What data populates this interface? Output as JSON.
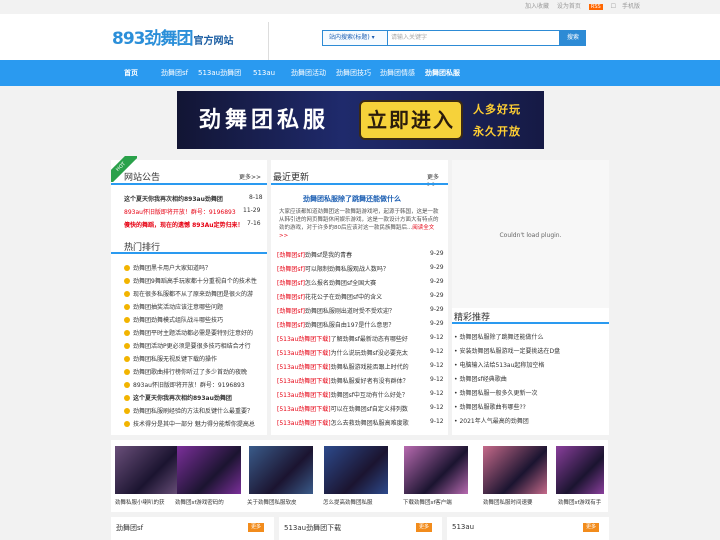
{
  "topbar": {
    "links": [
      "加入收藏",
      "设为首页"
    ],
    "rss": "RSS",
    "phone": "手机版"
  },
  "logo": {
    "main": "893劲舞团",
    "sub": "官方网站"
  },
  "search": {
    "select": "站内搜索(标题)",
    "placeholder": "请输入关键字",
    "button": "搜索"
  },
  "nav": [
    "首页",
    "劲舞团sf",
    "513au劲舞团",
    "513au",
    "劲舞团活动",
    "劲舞团技巧",
    "劲舞团情感",
    "劲舞团私服"
  ],
  "banner": {
    "title": "劲舞团私服",
    "enter": "立即进入",
    "slogan1": "人多好玩",
    "slogan2": "永久开放"
  },
  "notice": {
    "badge": "HOT",
    "title": "网站公告",
    "more": "更多>>",
    "items": [
      {
        "text": "这个夏天你我再次相约893au劲舞团",
        "date": "8-18",
        "style": "bold"
      },
      {
        "text": "893au怀旧版即将开放！群号：9196893",
        "date": "11-29",
        "style": "red"
      },
      {
        "text": "傻快的舞蹈，现在的遗憾 893Au定势归来！",
        "date": "7-16",
        "style": "redbold"
      }
    ]
  },
  "hot": {
    "title": "热门排行",
    "items": [
      "劲舞团黑卡用户大家知道吗？",
      "劲舞团9舞蹈高手玩家都十分重视自个的技术性",
      "现在很多私服都不从了原来劲舞团是很火的游",
      "劲舞团抽奖活动应该注意哪些问题",
      "劲舞团劲舞模式组队战斗哪些技巧",
      "劲舞团平时主题活动都必需是要特别注意好的",
      "劲舞团活动P更必须是要很多技巧相结合才行",
      "劲舞团私服无视反键下载的操作",
      "劲舞团歌曲排行榜你听过了多少首劲的夜晚",
      "893au怀旧版即将开放！群号：9196893",
      "这个夏天你我再次相约893au劲舞团",
      "劲舞团私服刷经验的方法和反键什么最重要？",
      "技术得分是其中一部分 魅力得分能帮你提高总"
    ]
  },
  "latest": {
    "title": "最近更新",
    "more": "更多>>",
    "headline": "劲舞团私服除了跳舞还能做什么",
    "summary": "大家应该都知道劲舞团这一款舞蹈游戏吧，起源于韩国，这是一款从韩引进的网页舞蹈休闲娱乐游戏，这是一款设计方面大有特点的劲的游戏，对于许多的80后应该对这一款民族舞蹈后...",
    "read": "阅读全文>>",
    "items": [
      {
        "tag": "[劲舞团sf]",
        "text": "劲舞sf是我的青春",
        "date": "9-29"
      },
      {
        "tag": "[劲舞团sf]",
        "text": "可以限制劲舞私服观战人数吗？",
        "date": "9-29"
      },
      {
        "tag": "[劲舞团sf]",
        "text": "怎么报名劲舞团sf全国大赛",
        "date": "9-29"
      },
      {
        "tag": "[劲舞团sf]",
        "text": "花花公子在劲舞团sf中的含义",
        "date": "9-29"
      },
      {
        "tag": "[劲舞团sf]",
        "text": "劲舞团私服刚出道时受不受欢迎？",
        "date": "9-29"
      },
      {
        "tag": "[劲舞团sf]",
        "text": "劲舞团私服自由197是什么意思？",
        "date": "9-29"
      },
      {
        "tag": "[513au劲舞团下载]",
        "text": "了解劲舞sf最新动态有哪些好",
        "date": "9-12"
      },
      {
        "tag": "[513au劲舞团下载]",
        "text": "为什么说玩劲舞sf没必要充太",
        "date": "9-12"
      },
      {
        "tag": "[513au劲舞团下载]",
        "text": "劲舞私服游戏能否跟上时代的",
        "date": "9-12"
      },
      {
        "tag": "[513au劲舞团下载]",
        "text": "劲舞私服爱好者有没有群体？",
        "date": "9-12"
      },
      {
        "tag": "[513au劲舞团下载]",
        "text": "劲舞团sf中互动有什么好处？",
        "date": "9-12"
      },
      {
        "tag": "[513au劲舞团下载]",
        "text": "可以在劲舞团sf自定义排列数",
        "date": "9-12"
      },
      {
        "tag": "[513au劲舞团下载]",
        "text": "怎么去救劲舞团私服高难度歌",
        "date": "9-12"
      }
    ]
  },
  "plugin": "Couldn't load plugin.",
  "recommend": {
    "title": "精彩推荐",
    "items": [
      "劲舞团私服除了跳舞还能做什么",
      "安装劲舞团私服游戏一定要挑选在D盘",
      "电脑输入法给513au起称加空格",
      "劲舞团sf经典歌曲",
      "劲舞团私服一般多久更新一次",
      "劲舞团私服歌曲有哪些??",
      "2021年人气最高的劲舞团"
    ]
  },
  "thumbs": [
    {
      "caption": "劲舞私服小喇叭的获",
      "color": "#6a4f7a"
    },
    {
      "caption": "劲舞团sf游戏密码的",
      "color": "#7b2f9a"
    },
    {
      "caption": "关于劲舞团私服软皮",
      "color": "#3a5b8a"
    },
    {
      "caption": "怎么提高劲舞团私服",
      "color": "#2d4a8c"
    },
    {
      "caption": "下载劲舞团sf客户端",
      "color": "#b86ab0"
    },
    {
      "caption": "劲舞团私服时间速要",
      "color": "#c66a8a"
    },
    {
      "caption": "劲舞团sf游戏有手",
      "color": "#8a3f9c"
    }
  ],
  "bottom": [
    {
      "title": "劲舞团sf",
      "more": "更多"
    },
    {
      "title": "513au劲舞团下载",
      "more": "更多"
    },
    {
      "title": "513au",
      "more": "更多"
    }
  ]
}
